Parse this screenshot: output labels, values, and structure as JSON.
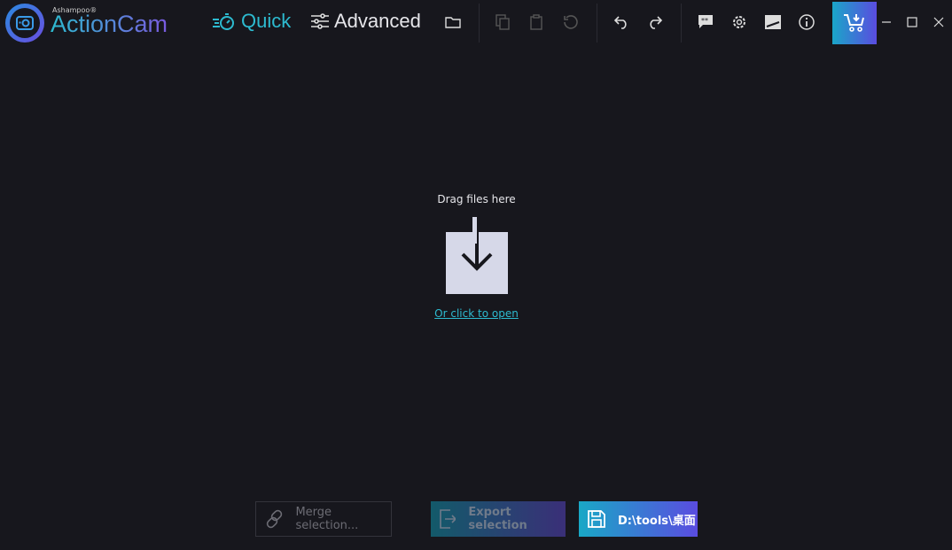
{
  "app": {
    "brand_small": "Ashampoo®",
    "brand": "ActionCam"
  },
  "modes": {
    "quick": "Quick",
    "advanced": "Advanced"
  },
  "colors": {
    "accent": "#2dbbd0",
    "accent2": "#5a4ce0",
    "background": "#17171d"
  },
  "dropzone": {
    "label": "Drag files here",
    "open_link": "Or click to open"
  },
  "bottom": {
    "merge": "Merge selection...",
    "export": "Export selection",
    "save_path": "D:\\tools\\桌面"
  }
}
